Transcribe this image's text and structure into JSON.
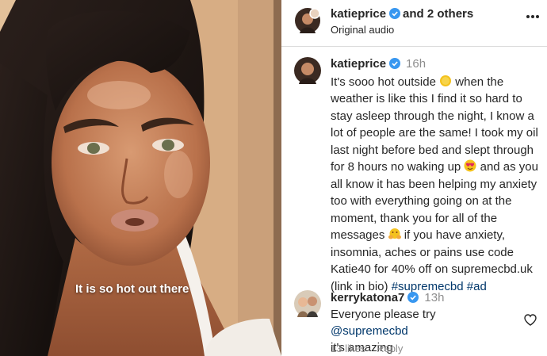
{
  "video": {
    "caption": "It is so hot out there"
  },
  "post_header": {
    "username": "katieprice",
    "others": "and 2 others",
    "audio": "Original audio",
    "more_icon": "more-horizontal-icon"
  },
  "caption": {
    "username": "katieprice",
    "time": "16h",
    "text_1": "It's sooo hot outside ",
    "emoji_1": "sun-emoji",
    "text_2": " when the weather is like this I find it so hard to stay asleep through the night, I know a lot of people are the same! I took my oil last night before bed and slept through for 8 hours no waking up ",
    "emoji_2": "heart-eyes-emoji",
    "text_3": " and as you all know it has been helping my anxiety too with everything going on at the moment, thank you for all of the messages ",
    "emoji_3": "hugging-emoji",
    "text_4": " if you have anxiety, insomnia, aches or pains use code Katie40 for 40% off on supremecbd.uk (link in bio) ",
    "hashtag_1": "#supremecbd",
    "hashtag_2": "#ad"
  },
  "comment": {
    "username": "kerrykatona7",
    "time": "13h",
    "text_1": "Everyone please try ",
    "mention": "@supremecbd",
    "text_2": " it's amazing",
    "likes": "13 likes",
    "reply": "Reply",
    "like_icon": "heart-outline-icon"
  },
  "colors": {
    "verified": "#3897f0",
    "link": "#00376b",
    "secondary_text": "#8e8e8e",
    "divider": "#dbdbdb"
  }
}
